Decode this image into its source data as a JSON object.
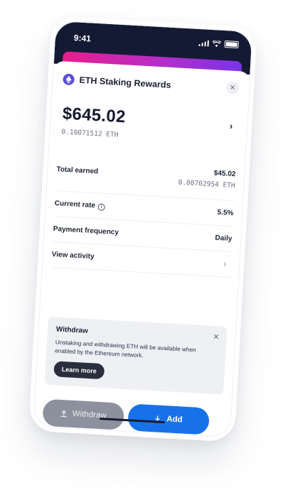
{
  "status_bar": {
    "time": "9:41"
  },
  "header": {
    "title": "ETH Staking Rewards",
    "close_label": "✕"
  },
  "balance": {
    "usd": "$645.02",
    "eth": "0.10071512 ETH",
    "chevron": "›"
  },
  "rows": {
    "total_earned": {
      "label": "Total earned",
      "usd": "$45.02",
      "eth": "0.00702954 ETH"
    },
    "current_rate": {
      "label": "Current rate",
      "info": "i",
      "value": "5.5%"
    },
    "payment_frequency": {
      "label": "Payment frequency",
      "value": "Daily"
    },
    "view_activity": {
      "label": "View activity",
      "chevron": "›"
    }
  },
  "withdraw_card": {
    "title": "Withdraw",
    "close": "✕",
    "text": "Unstaking and withdrawing ETH will be available when enabled by the Ethereum network.",
    "learn_more": "Learn more"
  },
  "buttons": {
    "withdraw": "Withdraw",
    "add": "Add"
  },
  "colors": {
    "accent": "#1772ea",
    "dark": "#141a33",
    "eth_icon": "#5b4fd9"
  }
}
